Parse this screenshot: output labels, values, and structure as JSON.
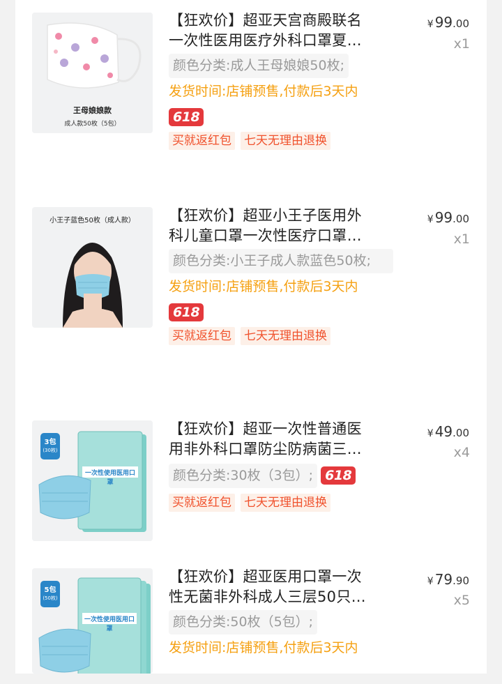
{
  "items": [
    {
      "title_line1": "【狂欢价】超亚天宫商殿联名",
      "title_line2": "一次性医用医疗外科口罩夏…",
      "sku_label": "颜色分类:",
      "sku_value": "成人王母娘娘50枚;",
      "ship_text": "发货时间:店铺预售,付款后3天内",
      "promo_badge": "618",
      "tags": [
        "买就返红包",
        "七天无理由退换"
      ],
      "price_currency": "¥",
      "price_int": "99",
      "price_dec": ".00",
      "qty": "x1",
      "thumb_caption_1": "王母娘娘款",
      "thumb_caption_2": "成人款50枚（5包）"
    },
    {
      "title_line1": "【狂欢价】超亚小王子医用外",
      "title_line2": "科儿童口罩一次性医疗口罩…",
      "sku_label": "颜色分类:",
      "sku_value": "小王子成人款蓝色50枚;",
      "ship_text": "发货时间:店铺预售,付款后3天内",
      "promo_badge": "618",
      "tags": [
        "买就返红包",
        "七天无理由退换"
      ],
      "price_currency": "¥",
      "price_int": "99",
      "price_dec": ".00",
      "qty": "x1",
      "thumb_caption_1": "小王子蓝色50枚（成人款）"
    },
    {
      "title_line1": "【狂欢价】超亚一次性普通医",
      "title_line2": "用非外科口罩防尘防病菌三…",
      "sku_label": "颜色分类:",
      "sku_value": "30枚（3包）;",
      "promo_badge": "618",
      "tags": [
        "买就返红包",
        "七天无理由退换"
      ],
      "price_currency": "¥",
      "price_int": "49",
      "price_dec": ".00",
      "qty": "x4",
      "thumb_badge_1": "3包",
      "thumb_badge_2": "(30枚)",
      "thumb_pack_label": "一次性使用医用口罩"
    },
    {
      "title_line1": "【狂欢价】超亚医用口罩一次",
      "title_line2": "性无菌非外科成人三层50只…",
      "sku_label": "颜色分类:",
      "sku_value": "50枚（5包）;",
      "ship_text": "发货时间:店铺预售,付款后3天内",
      "price_currency": "¥",
      "price_int": "79",
      "price_dec": ".90",
      "qty": "x5",
      "thumb_badge_1": "5包",
      "thumb_badge_2": "(50枚)",
      "thumb_pack_label": "一次性使用医用口罩"
    }
  ],
  "colors": {
    "ship": "#f5a011",
    "promo_red": "#e4393c",
    "tag_text": "#f0522d",
    "tag_bg": "#fdf0e8",
    "mask_blue": "#8ecfe6"
  }
}
